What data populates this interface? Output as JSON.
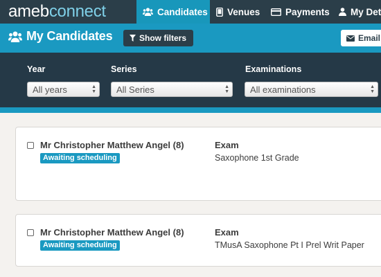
{
  "app": {
    "logo_part1": "ameb",
    "logo_part2": "connect"
  },
  "nav": {
    "tabs": [
      {
        "label": "Candidates",
        "icon": "users-icon",
        "active": true
      },
      {
        "label": "Venues",
        "icon": "mobile-icon",
        "active": false
      },
      {
        "label": "Payments",
        "icon": "credit-card-icon",
        "active": false
      },
      {
        "label": "My Det",
        "icon": "user-icon",
        "active": false
      }
    ]
  },
  "header": {
    "title": "My Candidates",
    "filters_button": "Show filters",
    "email_button": "Email s"
  },
  "filters": {
    "year": {
      "label": "Year",
      "value": "All years"
    },
    "series": {
      "label": "Series",
      "value": "All Series"
    },
    "examinations": {
      "label": "Examinations",
      "value": "All examinations"
    }
  },
  "candidates": [
    {
      "name": "Mr Christopher Matthew Angel (8)",
      "status": "Awaiting scheduling",
      "exam_heading": "Exam",
      "exam": "Saxophone 1st Grade"
    },
    {
      "name": "Mr Christopher Matthew Angel (8)",
      "status": "Awaiting scheduling",
      "exam_heading": "Exam",
      "exam": "TMusA Saxophone Pt I Prel Writ Paper"
    }
  ],
  "colors": {
    "nav_bg": "#2b3e49",
    "accent": "#1a99c1",
    "filters_bg": "#253947"
  }
}
